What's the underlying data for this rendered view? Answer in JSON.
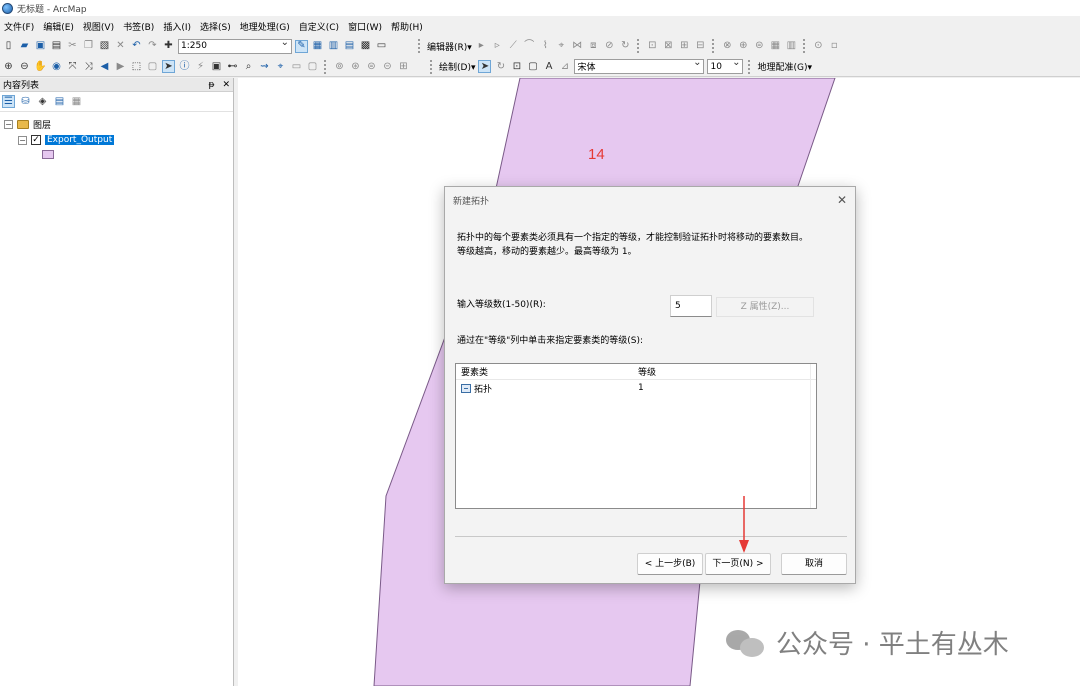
{
  "window": {
    "title": "无标题 - ArcMap"
  },
  "menu": [
    "文件(F)",
    "编辑(E)",
    "视图(V)",
    "书签(B)",
    "插入(I)",
    "选择(S)",
    "地理处理(G)",
    "自定义(C)",
    "窗口(W)",
    "帮助(H)"
  ],
  "toolbar": {
    "scale_value": "1:250",
    "editor_label": "编辑器(R)▾",
    "draw_label": "绘制(D)▾",
    "font_name": "宋体",
    "font_size": "10",
    "georef_label": "地理配准(G)▾",
    "text_tool": "A"
  },
  "toc": {
    "title": "内容列表",
    "pin": "ᵽ",
    "close": "✕",
    "group_name": "图层",
    "layer_name": "Export_Output",
    "layer_checked": "✓",
    "swatch_color": "#e6c8f0"
  },
  "map": {
    "label": "14",
    "polygon_fill": "#e6c8f0"
  },
  "dialog": {
    "title": "新建拓扑",
    "close": "✕",
    "description_line1": "拓扑中的每个要素类必须具有一个指定的等级，才能控制验证拓扑时将移动的要素数目。",
    "description_line2": "等级越高，移动的要素越少。最高等级为 1。",
    "rank_count_label": "输入等级数(1-50)(R):",
    "rank_count_value": "5",
    "z_properties_button": "Z 属性(Z)...",
    "assign_label": "通过在\"等级\"列中单击来指定要素类的等级(S):",
    "table": {
      "headers": [
        "要素类",
        "等级"
      ],
      "rows": [
        {
          "feature_class": "拓扑",
          "rank": "1"
        }
      ]
    },
    "buttons": {
      "back": "< 上一步(B)",
      "next": "下一页(N) >",
      "cancel": "取消"
    }
  },
  "watermark": {
    "text": "公众号 · 平土有丛木"
  }
}
